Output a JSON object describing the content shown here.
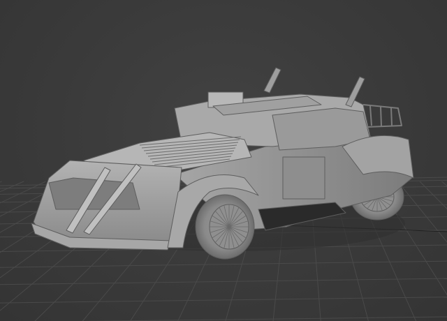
{
  "viewport": {
    "background_color": "#3b3b3b",
    "grid_color": "#4a4a4a",
    "grid_axis_color": "#1f1f1f",
    "shading_mode": "shaded-with-wireframe",
    "model_color": "#9c9c9c",
    "edge_color": "#5e5e5e",
    "icon": "3d-model-icon"
  }
}
